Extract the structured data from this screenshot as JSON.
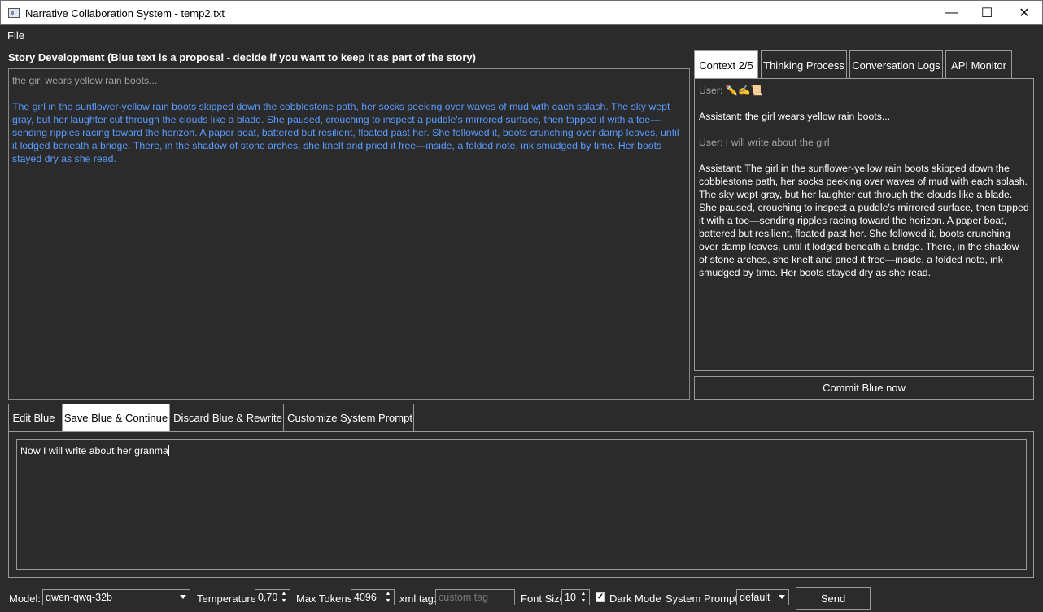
{
  "window": {
    "title": "Narrative Collaboration System - temp2.txt",
    "minimize_glyph": "—",
    "maximize_glyph": "☐",
    "close_glyph": "✕"
  },
  "menu": {
    "file": "File"
  },
  "story": {
    "heading": "Story Development (Blue text is a proposal - decide if you want to keep it as part of the story)",
    "accepted_text": "the girl wears yellow rain boots...",
    "proposal_text": "The girl in the sunflower-yellow rain boots skipped down the cobblestone path, her socks peeking over waves of mud with each splash. The sky wept gray, but her laughter cut through the clouds like a blade. She paused, crouching to inspect a puddle's mirrored surface, then tapped it with a toe—sending ripples racing toward the horizon. A paper boat, battered but resilient, floated past her. She followed it, boots crunching over damp leaves, until it lodged beneath a bridge. There, in the shadow of stone arches, she knelt and pried it free—inside, a folded note, ink smudged by time. Her boots stayed dry as she read.",
    "proposal_color": "#5b9bff"
  },
  "right_tabs": [
    {
      "label": "Context 2/5",
      "active": true
    },
    {
      "label": "Thinking Process",
      "active": false
    },
    {
      "label": "Conversation Logs",
      "active": false
    },
    {
      "label": "API Monitor",
      "active": false
    }
  ],
  "context": {
    "messages": [
      {
        "role": "user",
        "text": "User: ✏️✍️📜"
      },
      {
        "role": "assistant",
        "text": "Assistant: the girl wears yellow rain boots..."
      },
      {
        "role": "user",
        "text": "User: I will write about the girl"
      },
      {
        "role": "assistant",
        "text": "Assistant: The girl in the sunflower-yellow rain boots skipped down the cobblestone path, her socks peeking over waves of mud with each splash. The sky wept gray, but her laughter cut through the clouds like a blade. She paused, crouching to inspect a puddle's mirrored surface, then tapped it with a toe—sending ripples racing toward the horizon. A paper boat, battered but resilient, floated past her. She followed it, boots crunching over damp leaves, until it lodged beneath a bridge. There, in the shadow of stone arches, she knelt and pried it free—inside, a folded note, ink smudged by time. Her boots stayed dry as she read."
      }
    ],
    "commit_label": "Commit Blue now"
  },
  "actions": {
    "edit_blue": "Edit Blue",
    "save_continue": "Save Blue & Continue",
    "discard_rewrite": "Discard Blue & Rewrite",
    "customize_prompt": "Customize System Prompt",
    "active": "save_continue"
  },
  "input": {
    "value": "Now I will write about her granma"
  },
  "controls": {
    "model_label": "Model:",
    "model_value": "qwen-qwq-32b",
    "temperature_label": "Temperature:",
    "temperature_value": "0,70",
    "max_tokens_label": "Max Tokens:",
    "max_tokens_value": "4096",
    "xml_tag_label": "xml tag:",
    "xml_tag_placeholder": "custom tag",
    "font_size_label": "Font Size:",
    "font_size_value": "10",
    "dark_mode_label": "Dark Mode",
    "dark_mode_checked": true,
    "checkmark_glyph": "✓",
    "spin_up_glyph": "▲",
    "spin_down_glyph": "▼",
    "system_prompt_label": "System Prompt:",
    "system_prompt_value": "default",
    "send_label": "Send"
  }
}
